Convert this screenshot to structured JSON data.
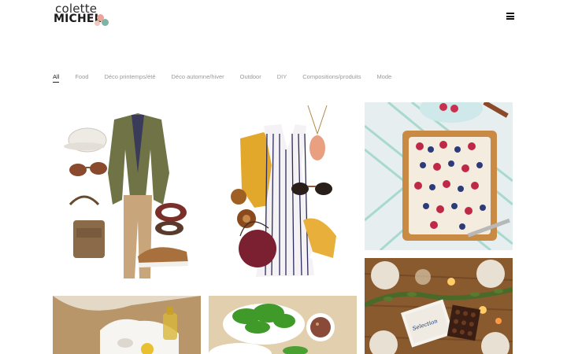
{
  "brand": {
    "line1": "colette",
    "line2": "MICHEL"
  },
  "filters": [
    {
      "label": "All",
      "active": true
    },
    {
      "label": "Food",
      "active": false
    },
    {
      "label": "Déco printemps/été",
      "active": false
    },
    {
      "label": "Déco automne/hiver",
      "active": false
    },
    {
      "label": "Outdoor",
      "active": false
    },
    {
      "label": "DIY",
      "active": false
    },
    {
      "label": "Compositions/produits",
      "active": false
    },
    {
      "label": "Mode",
      "active": false
    }
  ],
  "tiles": {
    "chocolate_box_label": "Selection"
  },
  "icons": {
    "menu": "hamburger-menu-icon"
  },
  "colors": {
    "text_active": "#222222",
    "text_muted": "#999999",
    "accent_pink": "#e9a79b",
    "accent_teal": "#7fb3a6"
  }
}
